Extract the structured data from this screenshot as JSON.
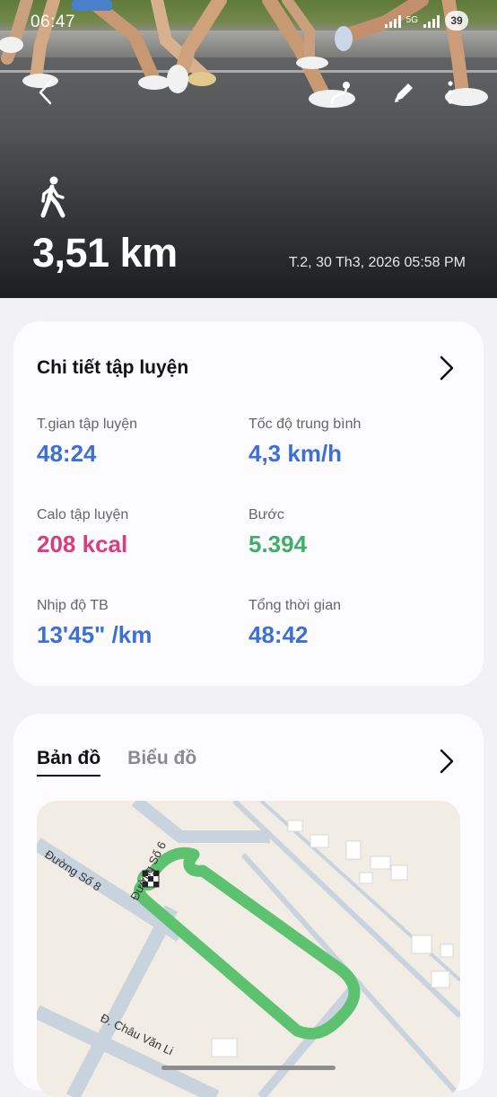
{
  "status_bar": {
    "time": "06:47",
    "network": "5G",
    "battery": "39"
  },
  "hero": {
    "distance": "3,51 km",
    "datetime": "T.2, 30 Th3, 2026 05:58 PM",
    "activity_icon": "walk-icon",
    "actions": [
      "back-icon",
      "route-icon",
      "edit-icon",
      "more-icon"
    ]
  },
  "details": {
    "title": "Chi tiết tập luyện",
    "stats": [
      {
        "label": "T.gian tập luyện",
        "value": "48:24",
        "color": "#3c6fd8"
      },
      {
        "label": "Tốc độ trung bình",
        "value": "4,3 km/h",
        "color": "#3c6fd8"
      },
      {
        "label": "Calo tập luyện",
        "value": "208 kcal",
        "color": "#d93d7c"
      },
      {
        "label": "Bước",
        "value": "5.394",
        "color": "#3fae66"
      },
      {
        "label": "Nhịp độ TB",
        "value": "13'45\" /km",
        "color": "#3c6fd8"
      },
      {
        "label": "Tổng thời gian",
        "value": "48:42",
        "color": "#3c6fd8"
      }
    ]
  },
  "map_card": {
    "tabs": [
      {
        "label": "Bản đồ",
        "active": true
      },
      {
        "label": "Biểu đồ",
        "active": false
      }
    ],
    "map": {
      "street_labels": [
        "Đường Số 8",
        "Đường Số 6",
        "Đ. Châu Văn Li"
      ],
      "route_color": "#5cc26f"
    }
  }
}
